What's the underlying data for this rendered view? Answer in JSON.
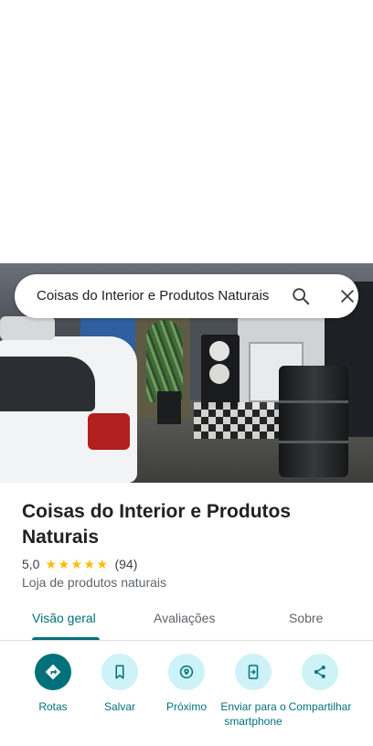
{
  "search": {
    "query": "Coisas do Interior e Produtos Naturais"
  },
  "place": {
    "name": "Coisas do Interior e Produtos Naturais",
    "rating": "5,0",
    "review_count": "(94)",
    "stars": 5,
    "category": "Loja de produtos naturais"
  },
  "tabs": [
    {
      "label": "Visão geral",
      "active": true
    },
    {
      "label": "Avaliações",
      "active": false
    },
    {
      "label": "Sobre",
      "active": false
    }
  ],
  "actions": [
    {
      "label": "Rotas",
      "icon": "directions-icon"
    },
    {
      "label": "Salvar",
      "icon": "bookmark-icon"
    },
    {
      "label": "Próximo",
      "icon": "nearby-icon"
    },
    {
      "label": "Enviar para o smartphone",
      "icon": "send-to-phone-icon"
    },
    {
      "label": "Compartilhar",
      "icon": "share-icon"
    }
  ],
  "colors": {
    "accent": "#00707a",
    "accent_light": "#cdf2f7",
    "star": "#fbbc04"
  }
}
